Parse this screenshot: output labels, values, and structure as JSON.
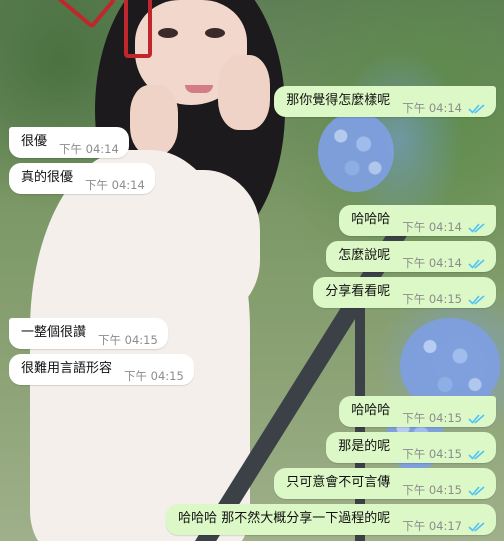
{
  "chat": {
    "messages": [
      {
        "dir": "out",
        "text": "那你覺得怎麼樣呢",
        "time": "下午 04:14",
        "status": "read"
      },
      {
        "dir": "in",
        "text": "很優",
        "time": "下午 04:14"
      },
      {
        "dir": "in",
        "text": "真的很優",
        "time": "下午 04:14"
      },
      {
        "dir": "out",
        "text": "哈哈哈",
        "time": "下午 04:14",
        "status": "read"
      },
      {
        "dir": "out",
        "text": "怎麼說呢",
        "time": "下午 04:14",
        "status": "read"
      },
      {
        "dir": "out",
        "text": "分享看看呢",
        "time": "下午 04:15",
        "status": "read"
      },
      {
        "dir": "in",
        "text": "一整個很讚",
        "time": "下午 04:15"
      },
      {
        "dir": "in",
        "text": "很難用言語形容",
        "time": "下午 04:15"
      },
      {
        "dir": "out",
        "text": "哈哈哈",
        "time": "下午 04:15",
        "status": "read"
      },
      {
        "dir": "out",
        "text": "那是的呢",
        "time": "下午 04:15",
        "status": "read"
      },
      {
        "dir": "out",
        "text": "只可意會不可言傳",
        "time": "下午 04:15",
        "status": "read"
      },
      {
        "dir": "out",
        "text": "哈哈哈 那不然大概分享一下過程的呢",
        "time": "下午 04:17",
        "status": "read"
      }
    ]
  },
  "colors": {
    "outgoing_bubble": "#dcf8c6",
    "incoming_bubble": "#ffffff",
    "read_check": "#4fc3f7",
    "time_text": "#8c8c8c"
  },
  "icons": {
    "read_receipt": "double-check-icon"
  },
  "wallpaper": {
    "description_icon": "wallpaper-photo"
  }
}
